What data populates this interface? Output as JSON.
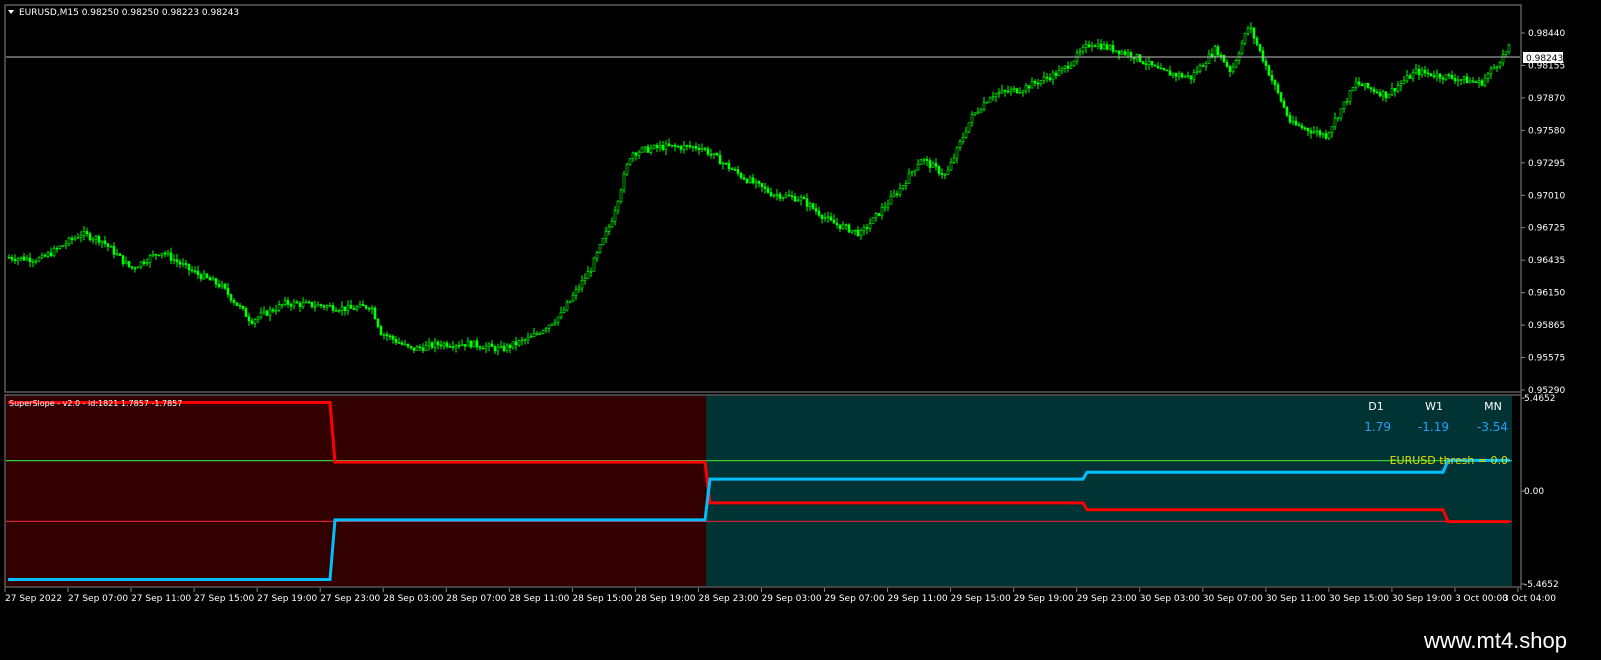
{
  "main_chart": {
    "header": "EURUSD,M15  0.98250 0.98250 0.98223 0.98243",
    "current_price": "0.98243",
    "price_ticks": [
      "0.98440",
      "0.98155",
      "0.97870",
      "0.97580",
      "0.97295",
      "0.97010",
      "0.96725",
      "0.96435",
      "0.96150",
      "0.95865",
      "0.95575",
      "0.95290"
    ],
    "candle_color": "#00ff00",
    "price_line_color": "#c0c0c0"
  },
  "indicator": {
    "header": "SuperSlope - v2.0 - id:1821 1.7857 -1.7857",
    "axis_ticks": [
      "5.4652",
      "0.00",
      "-5.4652"
    ],
    "threshold_label": "EURUSD thresh = 0.0",
    "table": {
      "columns": [
        "D1",
        "W1",
        "MN"
      ],
      "values": [
        "1.79",
        "-1.19",
        "-3.54"
      ]
    },
    "bg_negative_color": "#330000",
    "bg_positive_color": "#003333",
    "upper_level_color": "#33cc33",
    "lower_level_color": "#cc2233",
    "red_line_color": "#ff0000",
    "blue_line_color": "#00bfff"
  },
  "time_axis": [
    "27 Sep 2022",
    "27 Sep 07:00",
    "27 Sep 11:00",
    "27 Sep 15:00",
    "27 Sep 19:00",
    "27 Sep 23:00",
    "28 Sep 03:00",
    "28 Sep 07:00",
    "28 Sep 11:00",
    "28 Sep 15:00",
    "28 Sep 19:00",
    "28 Sep 23:00",
    "29 Sep 03:00",
    "29 Sep 07:00",
    "29 Sep 11:00",
    "29 Sep 15:00",
    "29 Sep 19:00",
    "29 Sep 23:00",
    "30 Sep 03:00",
    "30 Sep 07:00",
    "30 Sep 11:00",
    "30 Sep 15:00",
    "30 Sep 19:00",
    "3 Oct 00:00",
    "3 Oct 04:00"
  ],
  "watermark": "www.mt4.shop",
  "chart_data": [
    {
      "type": "candlestick",
      "title": "EURUSD,M15",
      "ylim": [
        0.9525,
        0.9855
      ],
      "close_path": [
        [
          0,
          0.964
        ],
        [
          40,
          0.9638
        ],
        [
          80,
          0.966
        ],
        [
          100,
          0.9655
        ],
        [
          130,
          0.963
        ],
        [
          160,
          0.9645
        ],
        [
          190,
          0.9628
        ],
        [
          220,
          0.9615
        ],
        [
          250,
          0.9585
        ],
        [
          285,
          0.96
        ],
        [
          320,
          0.9598
        ],
        [
          350,
          0.9595
        ],
        [
          370,
          0.9598
        ],
        [
          380,
          0.9575
        ],
        [
          410,
          0.956
        ],
        [
          440,
          0.9565
        ],
        [
          470,
          0.9565
        ],
        [
          500,
          0.956
        ],
        [
          530,
          0.957
        ],
        [
          560,
          0.959
        ],
        [
          590,
          0.963
        ],
        [
          610,
          0.967
        ],
        [
          630,
          0.973
        ],
        [
          660,
          0.9735
        ],
        [
          700,
          0.9735
        ],
        [
          740,
          0.971
        ],
        [
          770,
          0.9695
        ],
        [
          800,
          0.969
        ],
        [
          830,
          0.967
        ],
        [
          860,
          0.966
        ],
        [
          880,
          0.968
        ],
        [
          900,
          0.97
        ],
        [
          920,
          0.9725
        ],
        [
          945,
          0.971
        ],
        [
          970,
          0.976
        ],
        [
          990,
          0.978
        ],
        [
          1020,
          0.9785
        ],
        [
          1060,
          0.98
        ],
        [
          1090,
          0.9825
        ],
        [
          1130,
          0.9815
        ],
        [
          1160,
          0.98
        ],
        [
          1190,
          0.9795
        ],
        [
          1215,
          0.982
        ],
        [
          1230,
          0.98
        ],
        [
          1248,
          0.984
        ],
        [
          1265,
          0.9805
        ],
        [
          1290,
          0.9755
        ],
        [
          1325,
          0.9745
        ],
        [
          1355,
          0.979
        ],
        [
          1385,
          0.978
        ],
        [
          1415,
          0.98
        ],
        [
          1450,
          0.9795
        ],
        [
          1480,
          0.979
        ],
        [
          1512,
          0.98243
        ]
      ]
    },
    {
      "type": "line",
      "title": "SuperSlope - v2.0 - id:1821 1.7857 -1.7857",
      "ylim": [
        -5.4652,
        5.4652
      ],
      "levels": [
        1.7857,
        -1.7857
      ],
      "series": [
        {
          "values": [
            [
              8,
              5.2
            ],
            [
              330,
              5.2
            ],
            [
              335,
              1.7
            ],
            [
              705,
              1.7
            ],
            [
              710,
              -0.7
            ],
            [
              1083,
              -0.7
            ],
            [
              1087,
              -1.1
            ],
            [
              1443,
              -1.1
            ],
            [
              1448,
              -1.8
            ],
            [
              1510,
              -1.8
            ]
          ]
        },
        {
          "values": [
            [
              8,
              -5.2
            ],
            [
              330,
              -5.2
            ],
            [
              335,
              -1.7
            ],
            [
              705,
              -1.7
            ],
            [
              710,
              0.7
            ],
            [
              1083,
              0.7
            ],
            [
              1087,
              1.1
            ],
            [
              1443,
              1.1
            ],
            [
              1448,
              1.8
            ],
            [
              1510,
              1.8
            ]
          ]
        }
      ]
    }
  ]
}
